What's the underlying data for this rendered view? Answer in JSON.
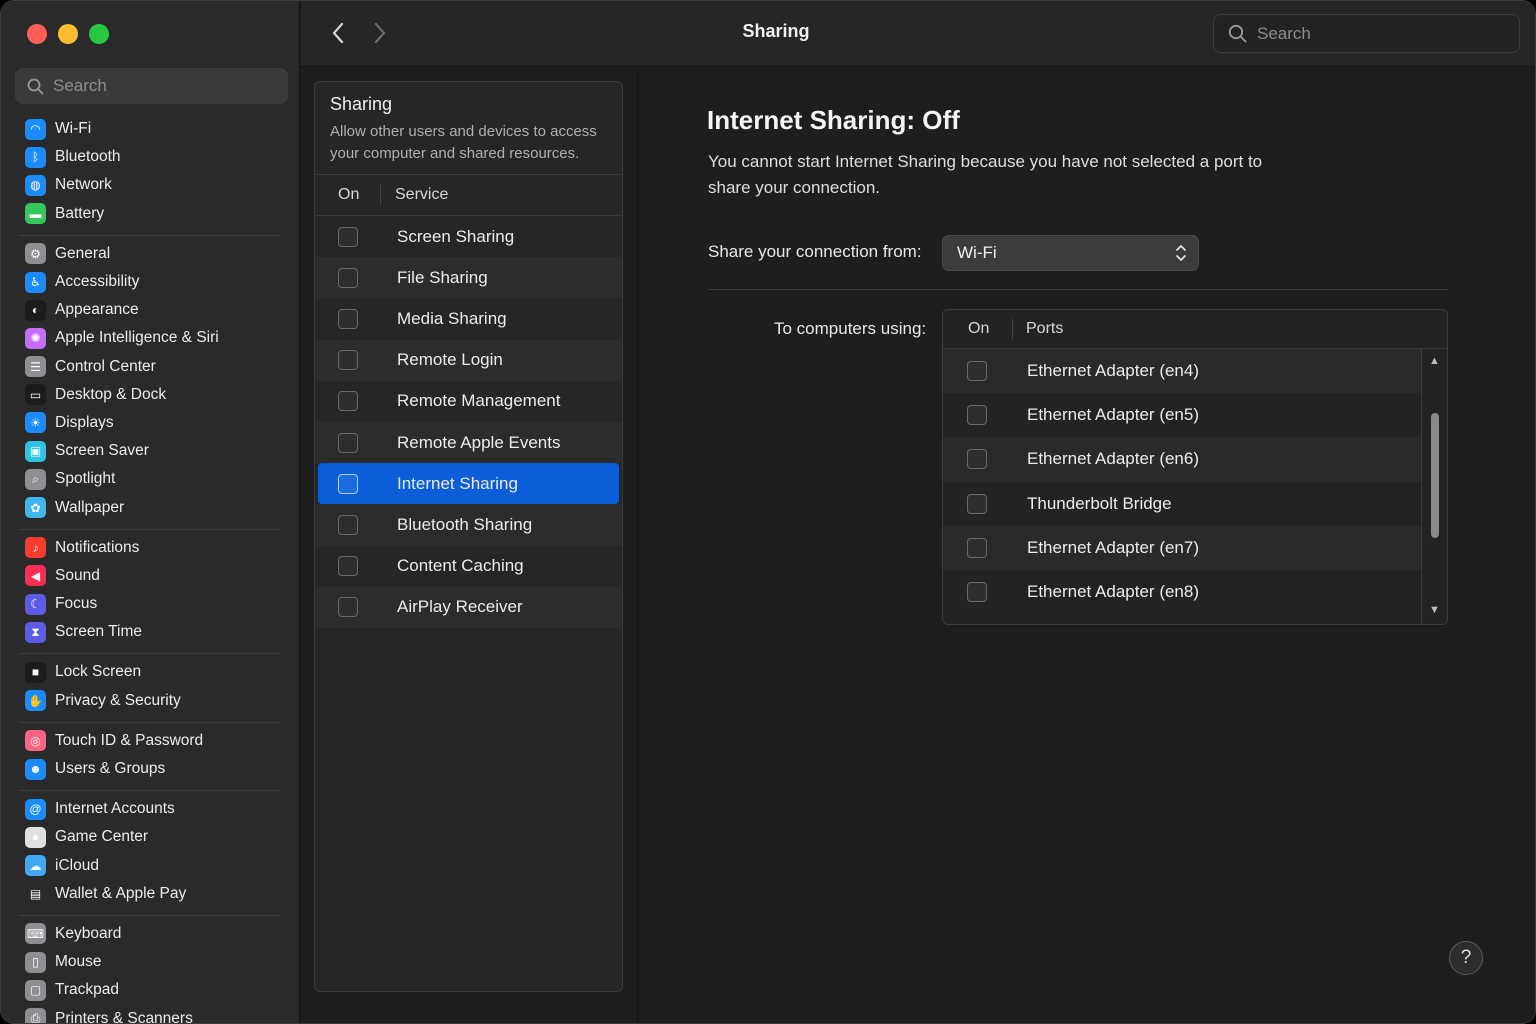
{
  "window": {
    "title": "Sharing",
    "search_placeholder": "Search"
  },
  "sidebar": {
    "search_placeholder": "Search",
    "groups": [
      [
        {
          "label": "Wi-Fi",
          "icon": "wifi-icon",
          "color": "#1a8cff"
        },
        {
          "label": "Bluetooth",
          "icon": "bluetooth-icon",
          "color": "#1a8cff"
        },
        {
          "label": "Network",
          "icon": "globe-icon",
          "color": "#1a8cff"
        },
        {
          "label": "Battery",
          "icon": "battery-icon",
          "color": "#34c759"
        }
      ],
      [
        {
          "label": "General",
          "icon": "gear-icon",
          "color": "#8e8e93"
        },
        {
          "label": "Accessibility",
          "icon": "accessibility-icon",
          "color": "#1a8cff"
        },
        {
          "label": "Appearance",
          "icon": "appearance-icon",
          "color": "#1c1c1e"
        },
        {
          "label": "Apple Intelligence & Siri",
          "icon": "siri-icon",
          "color": "#c86bff"
        },
        {
          "label": "Control Center",
          "icon": "control-center-icon",
          "color": "#8e8e93"
        },
        {
          "label": "Desktop & Dock",
          "icon": "dock-icon",
          "color": "#1c1c1e"
        },
        {
          "label": "Displays",
          "icon": "sun-icon",
          "color": "#1a8cff"
        },
        {
          "label": "Screen Saver",
          "icon": "screen-saver-icon",
          "color": "#2ec3e6"
        },
        {
          "label": "Spotlight",
          "icon": "magnifier-icon",
          "color": "#8e8e93"
        },
        {
          "label": "Wallpaper",
          "icon": "flower-icon",
          "color": "#3fb6f0"
        }
      ],
      [
        {
          "label": "Notifications",
          "icon": "bell-icon",
          "color": "#ff3b30"
        },
        {
          "label": "Sound",
          "icon": "speaker-icon",
          "color": "#ff2d55"
        },
        {
          "label": "Focus",
          "icon": "moon-icon",
          "color": "#5e5ce6"
        },
        {
          "label": "Screen Time",
          "icon": "hourglass-icon",
          "color": "#5e5ce6"
        }
      ],
      [
        {
          "label": "Lock Screen",
          "icon": "lock-icon",
          "color": "#1c1c1e"
        },
        {
          "label": "Privacy & Security",
          "icon": "hand-icon",
          "color": "#1a8cff"
        }
      ],
      [
        {
          "label": "Touch ID & Password",
          "icon": "fingerprint-icon",
          "color": "#ff6482"
        },
        {
          "label": "Users & Groups",
          "icon": "users-icon",
          "color": "#1a8cff"
        }
      ],
      [
        {
          "label": "Internet Accounts",
          "icon": "at-icon",
          "color": "#1a8cff"
        },
        {
          "label": "Game Center",
          "icon": "game-center-icon",
          "color": "#e0e0e0"
        },
        {
          "label": "iCloud",
          "icon": "cloud-icon",
          "color": "#3fa9f5"
        },
        {
          "label": "Wallet & Apple Pay",
          "icon": "wallet-icon",
          "color": "#2a2a2a"
        }
      ],
      [
        {
          "label": "Keyboard",
          "icon": "keyboard-icon",
          "color": "#8e8e93"
        },
        {
          "label": "Mouse",
          "icon": "mouse-icon",
          "color": "#8e8e93"
        },
        {
          "label": "Trackpad",
          "icon": "trackpad-icon",
          "color": "#8e8e93"
        },
        {
          "label": "Printers & Scanners",
          "icon": "printer-icon",
          "color": "#8e8e93"
        }
      ]
    ]
  },
  "services": {
    "title": "Sharing",
    "description": "Allow other users and devices to access your computer and shared resources.",
    "col_on": "On",
    "col_service": "Service",
    "items": [
      {
        "label": "Screen Sharing",
        "on": false,
        "selected": false
      },
      {
        "label": "File Sharing",
        "on": false,
        "selected": false
      },
      {
        "label": "Media Sharing",
        "on": false,
        "selected": false
      },
      {
        "label": "Remote Login",
        "on": false,
        "selected": false
      },
      {
        "label": "Remote Management",
        "on": false,
        "selected": false
      },
      {
        "label": "Remote Apple Events",
        "on": false,
        "selected": false
      },
      {
        "label": "Internet Sharing",
        "on": false,
        "selected": true
      },
      {
        "label": "Bluetooth Sharing",
        "on": false,
        "selected": false
      },
      {
        "label": "Content Caching",
        "on": false,
        "selected": false
      },
      {
        "label": "AirPlay Receiver",
        "on": false,
        "selected": false
      }
    ]
  },
  "detail": {
    "title": "Internet Sharing: Off",
    "description": "You cannot start Internet Sharing because you have not selected a port to share your connection.",
    "share_from_label": "Share your connection from:",
    "share_from_value": "Wi-Fi",
    "to_label": "To computers using:",
    "ports_col_on": "On",
    "ports_col_ports": "Ports",
    "ports": [
      {
        "label": "Ethernet Adapter (en4)",
        "on": false
      },
      {
        "label": "Ethernet Adapter (en5)",
        "on": false
      },
      {
        "label": "Ethernet Adapter (en6)",
        "on": false
      },
      {
        "label": "Thunderbolt Bridge",
        "on": false
      },
      {
        "label": "Ethernet Adapter (en7)",
        "on": false
      },
      {
        "label": "Ethernet Adapter (en8)",
        "on": false
      }
    ],
    "help_label": "?"
  },
  "colors": {
    "accent": "#0b5ed7",
    "background": "#1e1e1e",
    "sidebar": "#2a2a2a"
  }
}
